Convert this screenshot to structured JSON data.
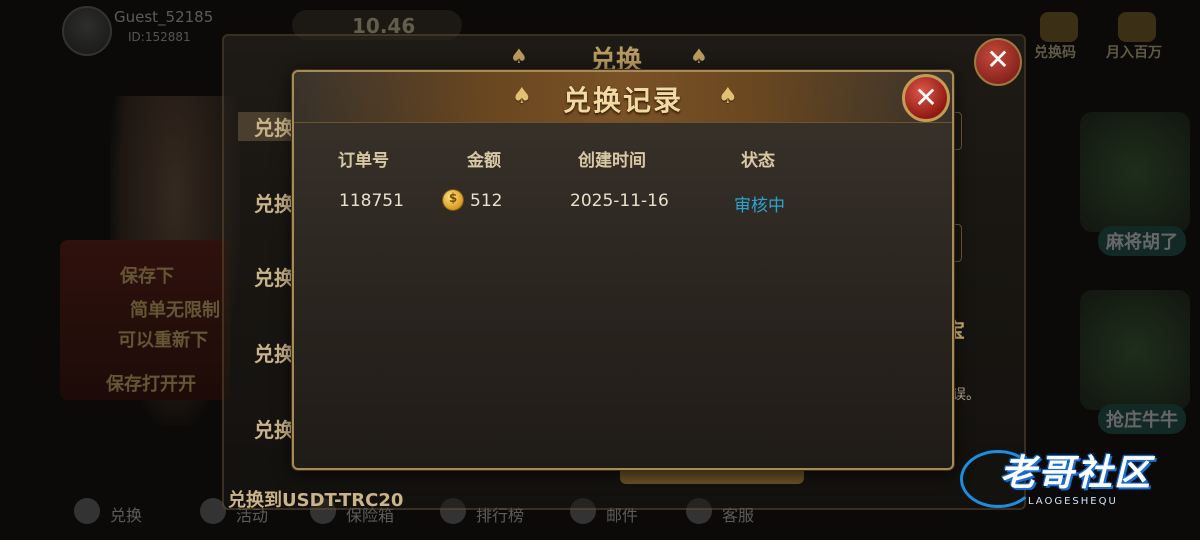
{
  "lobby": {
    "player_name": "Guest_52185",
    "player_id": "ID:152881",
    "coins": "10.46",
    "top_icons": [
      "兑换码",
      "月入百万"
    ],
    "banner_lines": [
      "保存下",
      "简单无限制",
      "可以重新下",
      "保存打开开"
    ],
    "side_games": [
      "麻将胡了",
      "抢庄牛牛"
    ],
    "bottom_nav": [
      "兑换",
      "活动",
      "保险箱",
      "排行榜",
      "邮件",
      "客服"
    ]
  },
  "exchange_panel": {
    "title": "兑换",
    "tabs": [
      "兑换",
      "兑换",
      "兑换",
      "兑换",
      "兑换"
    ],
    "footer_label": "兑换到USDT-TRC20",
    "side_button": "宝",
    "hint_fragment": "误。"
  },
  "dialog": {
    "title": "兑换记录",
    "columns": [
      "订单号",
      "金额",
      "创建时间",
      "状态"
    ],
    "rows": [
      {
        "order_no": "118751",
        "amount": "512",
        "created": "2025-11-16",
        "status": "审核中"
      }
    ]
  },
  "watermark": {
    "text": "老哥社区",
    "sub": "LAOGESHEQU"
  },
  "colors": {
    "status_pending": "#2ba4d2",
    "title_gold": "#f2dba3",
    "close_red": "#c0342a"
  }
}
